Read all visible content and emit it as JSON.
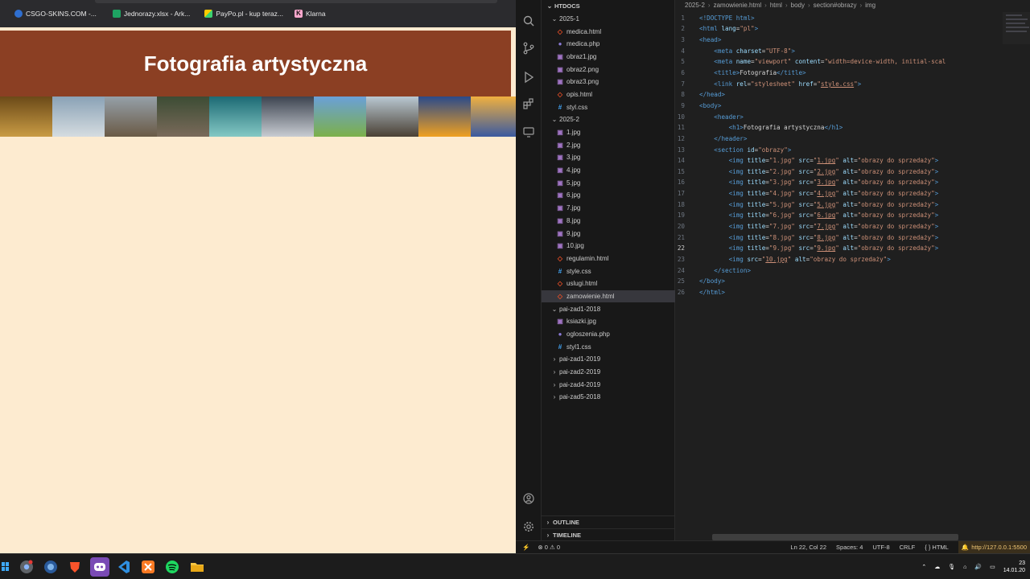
{
  "browser": {
    "bookmarks": [
      {
        "label": "CSGO-SKINS.COM -...",
        "color": "#2f6fd0"
      },
      {
        "label": "Jednorazy.xlsx - Ark...",
        "color": "#1ea362"
      },
      {
        "label": "PayPo.pl - kup teraz...",
        "color": "#ffcc00"
      },
      {
        "label": "Klarna",
        "color": "#ffa8cd"
      }
    ],
    "page": {
      "title": "Fotografia artystyczna",
      "background": "#fdebd0",
      "header_color": "#8b3f23"
    },
    "gallery": [
      {
        "icon": "photo-1",
        "colors": [
          "#6b4a18",
          "#c99b44"
        ]
      },
      {
        "icon": "photo-2",
        "colors": [
          "#8aa2b6",
          "#d5dce0"
        ]
      },
      {
        "icon": "photo-3",
        "colors": [
          "#95a0a8",
          "#6a5a46"
        ]
      },
      {
        "icon": "photo-4",
        "colors": [
          "#3c4c34",
          "#7a6a5a"
        ]
      },
      {
        "icon": "photo-5",
        "colors": [
          "#1c6a74",
          "#84c8c4"
        ]
      },
      {
        "icon": "photo-6",
        "colors": [
          "#3d4450",
          "#c8ccd2"
        ]
      },
      {
        "icon": "photo-7",
        "colors": [
          "#6aa0d8",
          "#7cb04a"
        ]
      },
      {
        "icon": "photo-8",
        "colors": [
          "#b9c8d2",
          "#4a4034"
        ]
      },
      {
        "icon": "photo-9",
        "colors": [
          "#2a4a8a",
          "#f0a020"
        ]
      },
      {
        "icon": "photo-10",
        "colors": [
          "#f0b040",
          "#3a5aa0"
        ]
      }
    ]
  },
  "vscode": {
    "explorer": {
      "title": "HTDOCS",
      "items": [
        {
          "label": "2025-1",
          "type": "folder-open",
          "depth": 0
        },
        {
          "label": "medica.html",
          "type": "html",
          "depth": 1
        },
        {
          "label": "medica.php",
          "type": "php",
          "depth": 1
        },
        {
          "label": "obraz1.jpg",
          "type": "img",
          "depth": 1
        },
        {
          "label": "obraz2.png",
          "type": "img",
          "depth": 1
        },
        {
          "label": "obraz3.png",
          "type": "img",
          "depth": 1
        },
        {
          "label": "opis.html",
          "type": "html",
          "depth": 1
        },
        {
          "label": "styl.css",
          "type": "css",
          "depth": 1
        },
        {
          "label": "2025-2",
          "type": "folder-open",
          "depth": 0
        },
        {
          "label": "1.jpg",
          "type": "img",
          "depth": 1
        },
        {
          "label": "2.jpg",
          "type": "img",
          "depth": 1
        },
        {
          "label": "3.jpg",
          "type": "img",
          "depth": 1
        },
        {
          "label": "4.jpg",
          "type": "img",
          "depth": 1
        },
        {
          "label": "5.jpg",
          "type": "img",
          "depth": 1
        },
        {
          "label": "6.jpg",
          "type": "img",
          "depth": 1
        },
        {
          "label": "7.jpg",
          "type": "img",
          "depth": 1
        },
        {
          "label": "8.jpg",
          "type": "img",
          "depth": 1
        },
        {
          "label": "9.jpg",
          "type": "img",
          "depth": 1
        },
        {
          "label": "10.jpg",
          "type": "img",
          "depth": 1
        },
        {
          "label": "regulamin.html",
          "type": "html",
          "depth": 1
        },
        {
          "label": "style.css",
          "type": "css",
          "depth": 1
        },
        {
          "label": "uslugi.html",
          "type": "html",
          "depth": 1
        },
        {
          "label": "zamowienie.html",
          "type": "html",
          "depth": 1,
          "selected": true
        },
        {
          "label": "pai-zad1-2018",
          "type": "folder-open",
          "depth": 0
        },
        {
          "label": "ksiazki.jpg",
          "type": "img",
          "depth": 1
        },
        {
          "label": "ogloszenia.php",
          "type": "php",
          "depth": 1
        },
        {
          "label": "styl1.css",
          "type": "css",
          "depth": 1
        },
        {
          "label": "pai-zad1-2019",
          "type": "folder",
          "depth": 0
        },
        {
          "label": "pai-zad2-2019",
          "type": "folder",
          "depth": 0
        },
        {
          "label": "pai-zad4-2019",
          "type": "folder",
          "depth": 0
        },
        {
          "label": "pai-zad5-2018",
          "type": "folder",
          "depth": 0
        }
      ],
      "outline_label": "OUTLINE",
      "timeline_label": "TIMELINE"
    },
    "breadcrumb": [
      "2025-2",
      "zamowienie.html",
      "html",
      "body",
      "section#obrazy",
      "img"
    ],
    "code_lines": [
      [
        [
          "t",
          "<!DOCTYPE html>"
        ]
      ],
      [
        [
          "t",
          "<html "
        ],
        [
          "a",
          "lang"
        ],
        [
          "x",
          "="
        ],
        [
          "s",
          "\"pl\""
        ],
        [
          "t",
          ">"
        ]
      ],
      [
        [
          "t",
          "<head>"
        ]
      ],
      [
        [
          "i",
          "    "
        ],
        [
          "t",
          "<meta "
        ],
        [
          "a",
          "charset"
        ],
        [
          "x",
          "="
        ],
        [
          "s",
          "\"UTF-8\""
        ],
        [
          "t",
          ">"
        ]
      ],
      [
        [
          "i",
          "    "
        ],
        [
          "t",
          "<meta "
        ],
        [
          "a",
          "name"
        ],
        [
          "x",
          "="
        ],
        [
          "s",
          "\"viewport\""
        ],
        [
          "x",
          " "
        ],
        [
          "a",
          "content"
        ],
        [
          "x",
          "="
        ],
        [
          "s",
          "\"width=device-width, initial-scal"
        ]
      ],
      [
        [
          "i",
          "    "
        ],
        [
          "t",
          "<title>"
        ],
        [
          "x",
          "Fotografia"
        ],
        [
          "t",
          "</title>"
        ]
      ],
      [
        [
          "i",
          "    "
        ],
        [
          "t",
          "<link "
        ],
        [
          "a",
          "rel"
        ],
        [
          "x",
          "="
        ],
        [
          "s",
          "\"stylesheet\""
        ],
        [
          "x",
          " "
        ],
        [
          "a",
          "href"
        ],
        [
          "x",
          "="
        ],
        [
          "s",
          "\""
        ],
        [
          "u",
          "style.css"
        ],
        [
          "s",
          "\""
        ],
        [
          "t",
          ">"
        ]
      ],
      [
        [
          "t",
          "</head>"
        ]
      ],
      [
        [
          "t",
          "<body>"
        ]
      ],
      [
        [
          "i",
          "    "
        ],
        [
          "t",
          "<header>"
        ]
      ],
      [
        [
          "i",
          "        "
        ],
        [
          "t",
          "<h1>"
        ],
        [
          "x",
          "Fotografia artystyczna"
        ],
        [
          "t",
          "</h1>"
        ]
      ],
      [
        [
          "i",
          "    "
        ],
        [
          "t",
          "</header>"
        ]
      ],
      [
        [
          "i",
          "    "
        ],
        [
          "t",
          "<section "
        ],
        [
          "a",
          "id"
        ],
        [
          "x",
          "="
        ],
        [
          "s",
          "\"obrazy\""
        ],
        [
          "t",
          ">"
        ]
      ],
      [
        [
          "i",
          "        "
        ],
        [
          "t",
          "<img "
        ],
        [
          "a",
          "title"
        ],
        [
          "x",
          "="
        ],
        [
          "s",
          "\"1.jpg\""
        ],
        [
          "x",
          " "
        ],
        [
          "a",
          "src"
        ],
        [
          "x",
          "="
        ],
        [
          "s",
          "\""
        ],
        [
          "u",
          "1.jpg"
        ],
        [
          "s",
          "\""
        ],
        [
          "x",
          " "
        ],
        [
          "a",
          "alt"
        ],
        [
          "x",
          "="
        ],
        [
          "s",
          "\"obrazy do sprzedaży\""
        ],
        [
          "t",
          ">"
        ]
      ],
      [
        [
          "i",
          "        "
        ],
        [
          "t",
          "<img "
        ],
        [
          "a",
          "title"
        ],
        [
          "x",
          "="
        ],
        [
          "s",
          "\"2.jpg\""
        ],
        [
          "x",
          " "
        ],
        [
          "a",
          "src"
        ],
        [
          "x",
          "="
        ],
        [
          "s",
          "\""
        ],
        [
          "u",
          "2.jpg"
        ],
        [
          "s",
          "\""
        ],
        [
          "x",
          " "
        ],
        [
          "a",
          "alt"
        ],
        [
          "x",
          "="
        ],
        [
          "s",
          "\"obrazy do sprzedaży\""
        ],
        [
          "t",
          ">"
        ]
      ],
      [
        [
          "i",
          "        "
        ],
        [
          "t",
          "<img "
        ],
        [
          "a",
          "title"
        ],
        [
          "x",
          "="
        ],
        [
          "s",
          "\"3.jpg\""
        ],
        [
          "x",
          " "
        ],
        [
          "a",
          "src"
        ],
        [
          "x",
          "="
        ],
        [
          "s",
          "\""
        ],
        [
          "u",
          "3.jpg"
        ],
        [
          "s",
          "\""
        ],
        [
          "x",
          " "
        ],
        [
          "a",
          "alt"
        ],
        [
          "x",
          "="
        ],
        [
          "s",
          "\"obrazy do sprzedaży\""
        ],
        [
          "t",
          ">"
        ]
      ],
      [
        [
          "i",
          "        "
        ],
        [
          "t",
          "<img "
        ],
        [
          "a",
          "title"
        ],
        [
          "x",
          "="
        ],
        [
          "s",
          "\"4.jpg\""
        ],
        [
          "x",
          " "
        ],
        [
          "a",
          "src"
        ],
        [
          "x",
          "="
        ],
        [
          "s",
          "\""
        ],
        [
          "u",
          "4.jpg"
        ],
        [
          "s",
          "\""
        ],
        [
          "x",
          " "
        ],
        [
          "a",
          "alt"
        ],
        [
          "x",
          "="
        ],
        [
          "s",
          "\"obrazy do sprzedaży\""
        ],
        [
          "t",
          ">"
        ]
      ],
      [
        [
          "i",
          "        "
        ],
        [
          "t",
          "<img "
        ],
        [
          "a",
          "title"
        ],
        [
          "x",
          "="
        ],
        [
          "s",
          "\"5.jpg\""
        ],
        [
          "x",
          " "
        ],
        [
          "a",
          "src"
        ],
        [
          "x",
          "="
        ],
        [
          "s",
          "\""
        ],
        [
          "u",
          "5.jpg"
        ],
        [
          "s",
          "\""
        ],
        [
          "x",
          " "
        ],
        [
          "a",
          "alt"
        ],
        [
          "x",
          "="
        ],
        [
          "s",
          "\"obrazy do sprzedaży\""
        ],
        [
          "t",
          ">"
        ]
      ],
      [
        [
          "i",
          "        "
        ],
        [
          "t",
          "<img "
        ],
        [
          "a",
          "title"
        ],
        [
          "x",
          "="
        ],
        [
          "s",
          "\"6.jpg\""
        ],
        [
          "x",
          " "
        ],
        [
          "a",
          "src"
        ],
        [
          "x",
          "="
        ],
        [
          "s",
          "\""
        ],
        [
          "u",
          "6.jpg"
        ],
        [
          "s",
          "\""
        ],
        [
          "x",
          " "
        ],
        [
          "a",
          "alt"
        ],
        [
          "x",
          "="
        ],
        [
          "s",
          "\"obrazy do sprzedaży\""
        ],
        [
          "t",
          ">"
        ]
      ],
      [
        [
          "i",
          "        "
        ],
        [
          "t",
          "<img "
        ],
        [
          "a",
          "title"
        ],
        [
          "x",
          "="
        ],
        [
          "s",
          "\"7.jpg\""
        ],
        [
          "x",
          " "
        ],
        [
          "a",
          "src"
        ],
        [
          "x",
          "="
        ],
        [
          "s",
          "\""
        ],
        [
          "u",
          "7.jpg"
        ],
        [
          "s",
          "\""
        ],
        [
          "x",
          " "
        ],
        [
          "a",
          "alt"
        ],
        [
          "x",
          "="
        ],
        [
          "s",
          "\"obrazy do sprzedaży\""
        ],
        [
          "t",
          ">"
        ]
      ],
      [
        [
          "i",
          "        "
        ],
        [
          "t",
          "<img "
        ],
        [
          "a",
          "title"
        ],
        [
          "x",
          "="
        ],
        [
          "s",
          "\"8.jpg\""
        ],
        [
          "x",
          " "
        ],
        [
          "a",
          "src"
        ],
        [
          "x",
          "="
        ],
        [
          "s",
          "\""
        ],
        [
          "u",
          "8.jpg"
        ],
        [
          "s",
          "\""
        ],
        [
          "x",
          " "
        ],
        [
          "a",
          "alt"
        ],
        [
          "x",
          "="
        ],
        [
          "s",
          "\"obrazy do sprzedaży\""
        ],
        [
          "t",
          ">"
        ]
      ],
      [
        [
          "i",
          "        "
        ],
        [
          "t",
          "<img "
        ],
        [
          "a",
          "title"
        ],
        [
          "x",
          "="
        ],
        [
          "s",
          "\"9.jpg\""
        ],
        [
          "x",
          " "
        ],
        [
          "a",
          "src"
        ],
        [
          "x",
          "="
        ],
        [
          "s",
          "\""
        ],
        [
          "u",
          "9.jpg"
        ],
        [
          "s",
          "\""
        ],
        [
          "x",
          " "
        ],
        [
          "a",
          "alt"
        ],
        [
          "x",
          "="
        ],
        [
          "s",
          "\"obrazy do sprzedaży\""
        ],
        [
          "t",
          ">"
        ]
      ],
      [
        [
          "i",
          "        "
        ],
        [
          "t",
          "<img "
        ],
        [
          "a",
          "src"
        ],
        [
          "x",
          "="
        ],
        [
          "s",
          "\""
        ],
        [
          "u",
          "10.jpg"
        ],
        [
          "s",
          "\""
        ],
        [
          "x",
          " "
        ],
        [
          "a",
          "alt"
        ],
        [
          "x",
          "="
        ],
        [
          "s",
          "\"obrazy do sprzedaży\""
        ],
        [
          "t",
          ">"
        ]
      ],
      [
        [
          "i",
          "    "
        ],
        [
          "t",
          "</section>"
        ]
      ],
      [
        [
          "t",
          "</body>"
        ]
      ],
      [
        [
          "t",
          "</html>"
        ]
      ]
    ],
    "active_line": 22,
    "statusbar": {
      "errors": "0",
      "warnings": "0",
      "position": "Ln 22, Col 22",
      "spaces": "Spaces: 4",
      "encoding": "UTF-8",
      "eol": "CRLF",
      "language": "HTML",
      "braces": "{ }",
      "live_server": "http://127.0.0.1:5500"
    }
  },
  "taskbar": {
    "apps": [
      "windows-start-icon",
      "chrome-icon",
      "edge-icon",
      "brave-icon",
      "discord-icon",
      "vscode-icon",
      "xampp-icon",
      "spotify-icon",
      "file-explorer-icon"
    ],
    "clock_time": "23",
    "clock_date": "14.01.20"
  }
}
